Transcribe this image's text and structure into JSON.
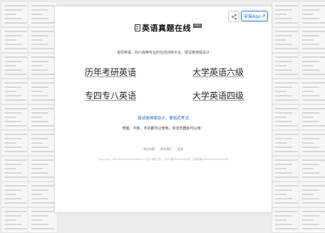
{
  "site": {
    "title": "英语真题在线",
    "badge": "PRO",
    "tagline": "考研英语、四六级等专业的在线训练平台，按试卷排版设计"
  },
  "header": {
    "share_icon": "share-icon",
    "app_button_label": "安装App",
    "app_button_icon": "external-link-icon",
    "accent_color": "#1a73e8"
  },
  "categories": [
    {
      "label": "历年考研英语"
    },
    {
      "label": "大学英语六级"
    },
    {
      "label": "专四专八英语"
    },
    {
      "label": "大学英语四级"
    }
  ],
  "promo": {
    "link_text": "按试卷排版设计，更贴近考试",
    "note": "电脑、平板、手机都可以使用，有浏览器就可以用！"
  },
  "footer": {
    "links": [
      "常见问题",
      "联系我们",
      "登录"
    ],
    "copyright": "Copyright 2025 Allinallinallinallinall.cn 复于满足工程... 浙ICP备XXXXXXXX号 | 公网安备XXXXXXXXXXXXXX号"
  }
}
